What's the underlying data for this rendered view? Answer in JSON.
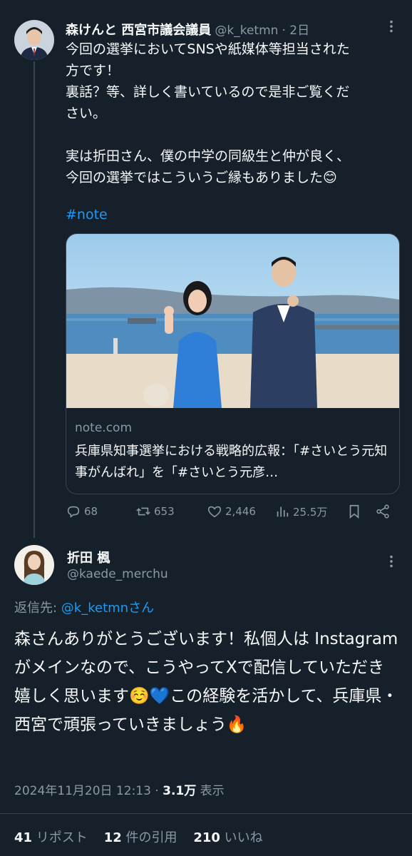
{
  "tweet1": {
    "name": "森けんと 西宮市議会議員",
    "handle": "@k_ketmn",
    "time": "· 2日",
    "text": "今回の選挙においてSNSや紙媒体等担当された\n方です！\n裏話？等、詳しく書いているので是非ご覧くだ\nさい。\n\n実は折田さん、僕の中学の同級生と仲が良く、\n今回の選挙ではこういうご縁もありました😊",
    "hashtag": "#note",
    "card": {
      "domain": "note.com",
      "title": "兵庫県知事選挙における戦略的広報：「#さいとう元知事がんばれ」を「#さいとう元彦…"
    },
    "actions": {
      "replies": "68",
      "retweets": "653",
      "likes": "2,446",
      "views": "25.5万"
    }
  },
  "tweet2": {
    "name": "折田 楓",
    "handle": "@kaede_merchu",
    "reply_prefix": "返信先: ",
    "reply_mention": "@k_ketmnさん",
    "text": "森さんありがとうございます！私個人は Instagramがメインなので、こうやってXで配信していただき嬉しく思います☺️💙この経験を活かして、兵庫県・西宮で頑張っていきましょう🔥",
    "date": "2024年11月20日 12:13 · ",
    "views": "3.1万",
    "views_label": " 表示",
    "retweets": "41",
    "retweets_label": " リポスト",
    "quotes": "12",
    "quotes_label": " 件の引用",
    "likes": "210",
    "likes_label": " いいね"
  },
  "colors": {
    "background": "#15202b",
    "accent": "#1d9bf0",
    "secondary_text": "#8b98a5",
    "border": "#38444d"
  },
  "icons": {
    "more": "more-horizontal-icon",
    "reply": "reply-icon",
    "retweet": "retweet-icon",
    "like": "heart-icon",
    "views": "bar-chart-icon",
    "bookmark": "bookmark-icon",
    "share": "share-icon"
  }
}
